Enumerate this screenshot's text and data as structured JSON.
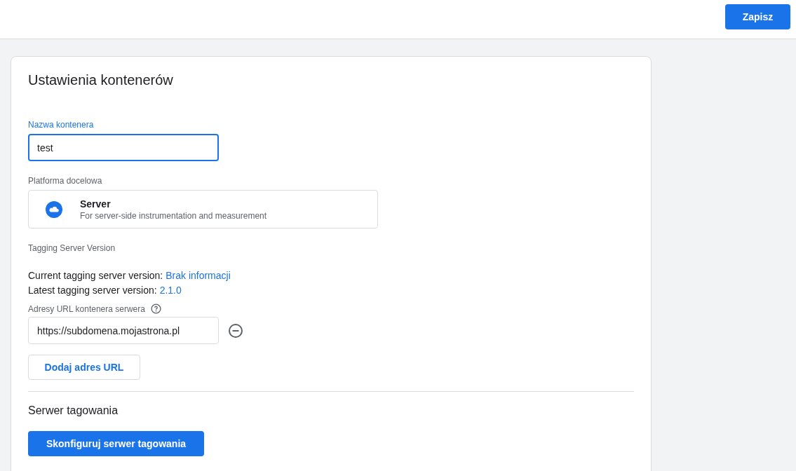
{
  "header": {
    "save_button": "Zapisz"
  },
  "card": {
    "title": "Ustawienia kontenerów",
    "name_field": {
      "label": "Nazwa kontenera",
      "value": "test",
      "focused": true
    },
    "platform": {
      "label": "Platforma docelowa",
      "option": {
        "title": "Server",
        "description": "For server-side instrumentation and measurement"
      }
    },
    "version": {
      "label": "Tagging Server Version",
      "lines": [
        {
          "text": "Current tagging server version:",
          "value": "Brak informacji"
        },
        {
          "text": "Latest tagging server version:",
          "value": "2.1.0"
        }
      ]
    },
    "urls": {
      "label": "Adresy URL kontenera serwera",
      "fields": [
        {
          "value": "https://subdomena.mojastrona.pl",
          "focused": false
        }
      ],
      "add_button": "Dodaj adres URL"
    },
    "tagging_server": {
      "title": "Serwer tagowania",
      "button": "Skonfiguruj serwer tagowania"
    }
  }
}
